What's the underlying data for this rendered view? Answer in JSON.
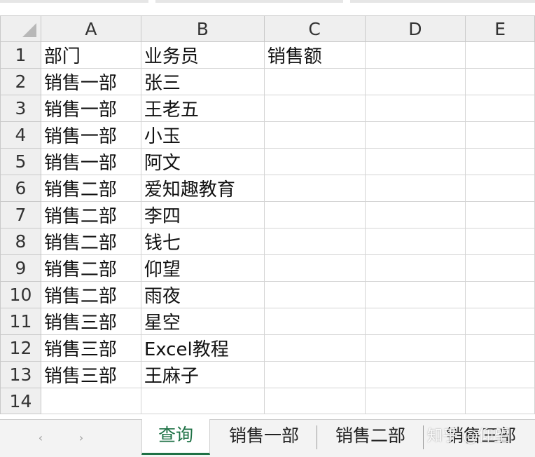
{
  "columns": [
    "A",
    "B",
    "C",
    "D",
    "E"
  ],
  "rows": [
    {
      "num": "1",
      "a": "部门",
      "b": "业务员",
      "c": "销售额"
    },
    {
      "num": "2",
      "a": "销售一部",
      "b": "张三",
      "c": ""
    },
    {
      "num": "3",
      "a": "销售一部",
      "b": "王老五",
      "c": ""
    },
    {
      "num": "4",
      "a": "销售一部",
      "b": "小玉",
      "c": ""
    },
    {
      "num": "5",
      "a": "销售一部",
      "b": "阿文",
      "c": ""
    },
    {
      "num": "6",
      "a": "销售二部",
      "b": "爱知趣教育",
      "c": ""
    },
    {
      "num": "7",
      "a": "销售二部",
      "b": "李四",
      "c": ""
    },
    {
      "num": "8",
      "a": "销售二部",
      "b": "钱七",
      "c": ""
    },
    {
      "num": "9",
      "a": "销售二部",
      "b": "仰望",
      "c": ""
    },
    {
      "num": "10",
      "a": "销售二部",
      "b": "雨夜",
      "c": ""
    },
    {
      "num": "11",
      "a": "销售三部",
      "b": "星空",
      "c": ""
    },
    {
      "num": "12",
      "a": "销售三部",
      "b": "Excel教程",
      "c": ""
    },
    {
      "num": "13",
      "a": "销售三部",
      "b": "王麻子",
      "c": ""
    },
    {
      "num": "14",
      "a": "",
      "b": "",
      "c": ""
    }
  ],
  "sheet_tabs": [
    {
      "label": "查询",
      "active": true
    },
    {
      "label": "销售一部",
      "active": false
    },
    {
      "label": "销售二部",
      "active": false
    },
    {
      "label": "销售三部",
      "active": false
    }
  ],
  "nav": {
    "prev_icon": "‹",
    "next_icon": "›"
  },
  "watermark": "知乎 @仰望",
  "colors": {
    "active_tab": "#1e7145",
    "header_bg": "#efefef",
    "gridline": "#d4d4d4"
  }
}
